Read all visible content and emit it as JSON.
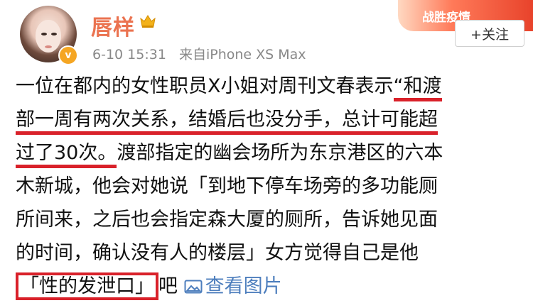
{
  "header": {
    "username": "唇样",
    "time": "6-10 15:31",
    "source": "来自iPhone XS Max",
    "follow_label": "+关注",
    "banner_text": "战胜疫情",
    "verified_symbol": "v"
  },
  "post": {
    "l1a": "一位在都内的女性职员X小姐对周刊文春表示",
    "l1b": "“和渡",
    "l2": "部一周有两次关系，结婚后也没分手，总计可能超",
    "l3a": "过了30次。",
    "l3b": "渡部指定的幽会场所为东京港区的六本",
    "l4": "木新城，他会对她说「到地下停车场旁的多功能厕",
    "l5": "所间来，之后也会指定森大厦的厕所，告诉她见面",
    "l6": "的时间，确认没有人的楼层」女方觉得自己是他",
    "l7a": "「性的发泄口」",
    "l7b": "吧",
    "view_images": "查看图片"
  },
  "colors": {
    "username": "#eb7350",
    "annotation_red": "#d9212a",
    "link_blue": "#4d7ebd",
    "meta_gray": "#888888"
  },
  "icons": [
    "avatar-photo",
    "verified-badge",
    "crown-icon",
    "image-icon"
  ]
}
